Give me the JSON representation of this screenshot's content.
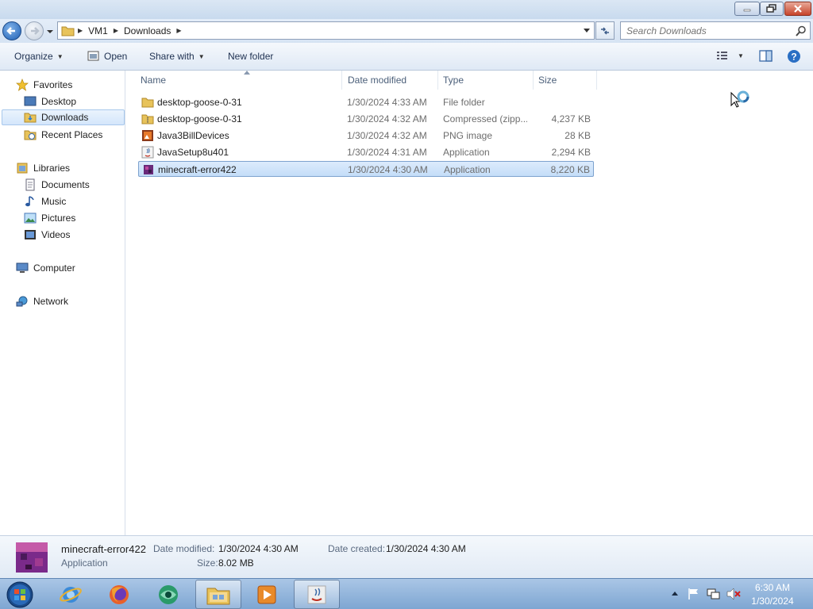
{
  "address": {
    "crumbs": [
      "VM1",
      "Downloads"
    ]
  },
  "search": {
    "placeholder": "Search Downloads"
  },
  "toolbar": {
    "organize": "Organize",
    "open": "Open",
    "share_with": "Share with",
    "new_folder": "New folder"
  },
  "nav": {
    "favorites": "Favorites",
    "desktop": "Desktop",
    "downloads": "Downloads",
    "recent_places": "Recent Places",
    "libraries": "Libraries",
    "documents": "Documents",
    "music": "Music",
    "pictures": "Pictures",
    "videos": "Videos",
    "computer": "Computer",
    "network": "Network"
  },
  "columns": {
    "name": "Name",
    "date": "Date modified",
    "type": "Type",
    "size": "Size"
  },
  "files": [
    {
      "name": "desktop-goose-0-31",
      "date": "1/30/2024 4:33 AM",
      "type": "File folder",
      "size": "",
      "icon": "folder-icon"
    },
    {
      "name": "desktop-goose-0-31",
      "date": "1/30/2024 4:32 AM",
      "type": "Compressed (zipp...",
      "size": "4,237 KB",
      "icon": "zip-folder-icon"
    },
    {
      "name": "Java3BillDevices",
      "date": "1/30/2024 4:32 AM",
      "type": "PNG image",
      "size": "28 KB",
      "icon": "image-icon"
    },
    {
      "name": "JavaSetup8u401",
      "date": "1/30/2024 4:31 AM",
      "type": "Application",
      "size": "2,294 KB",
      "icon": "java-icon"
    },
    {
      "name": "minecraft-error422",
      "date": "1/30/2024 4:30 AM",
      "type": "Application",
      "size": "8,220 KB",
      "icon": "minecraft-icon"
    }
  ],
  "details": {
    "name": "minecraft-error422",
    "type": "Application",
    "date_modified_label": "Date modified:",
    "date_modified": "1/30/2024 4:30 AM",
    "date_created_label": "Date created:",
    "date_created": "1/30/2024 4:30 AM",
    "size_label": "Size:",
    "size": "8.02 MB"
  },
  "clock": {
    "time": "6:30 AM",
    "date": "1/30/2024"
  },
  "colors": {
    "selection": "#cce4fa",
    "accent": "#1f5fb3"
  }
}
